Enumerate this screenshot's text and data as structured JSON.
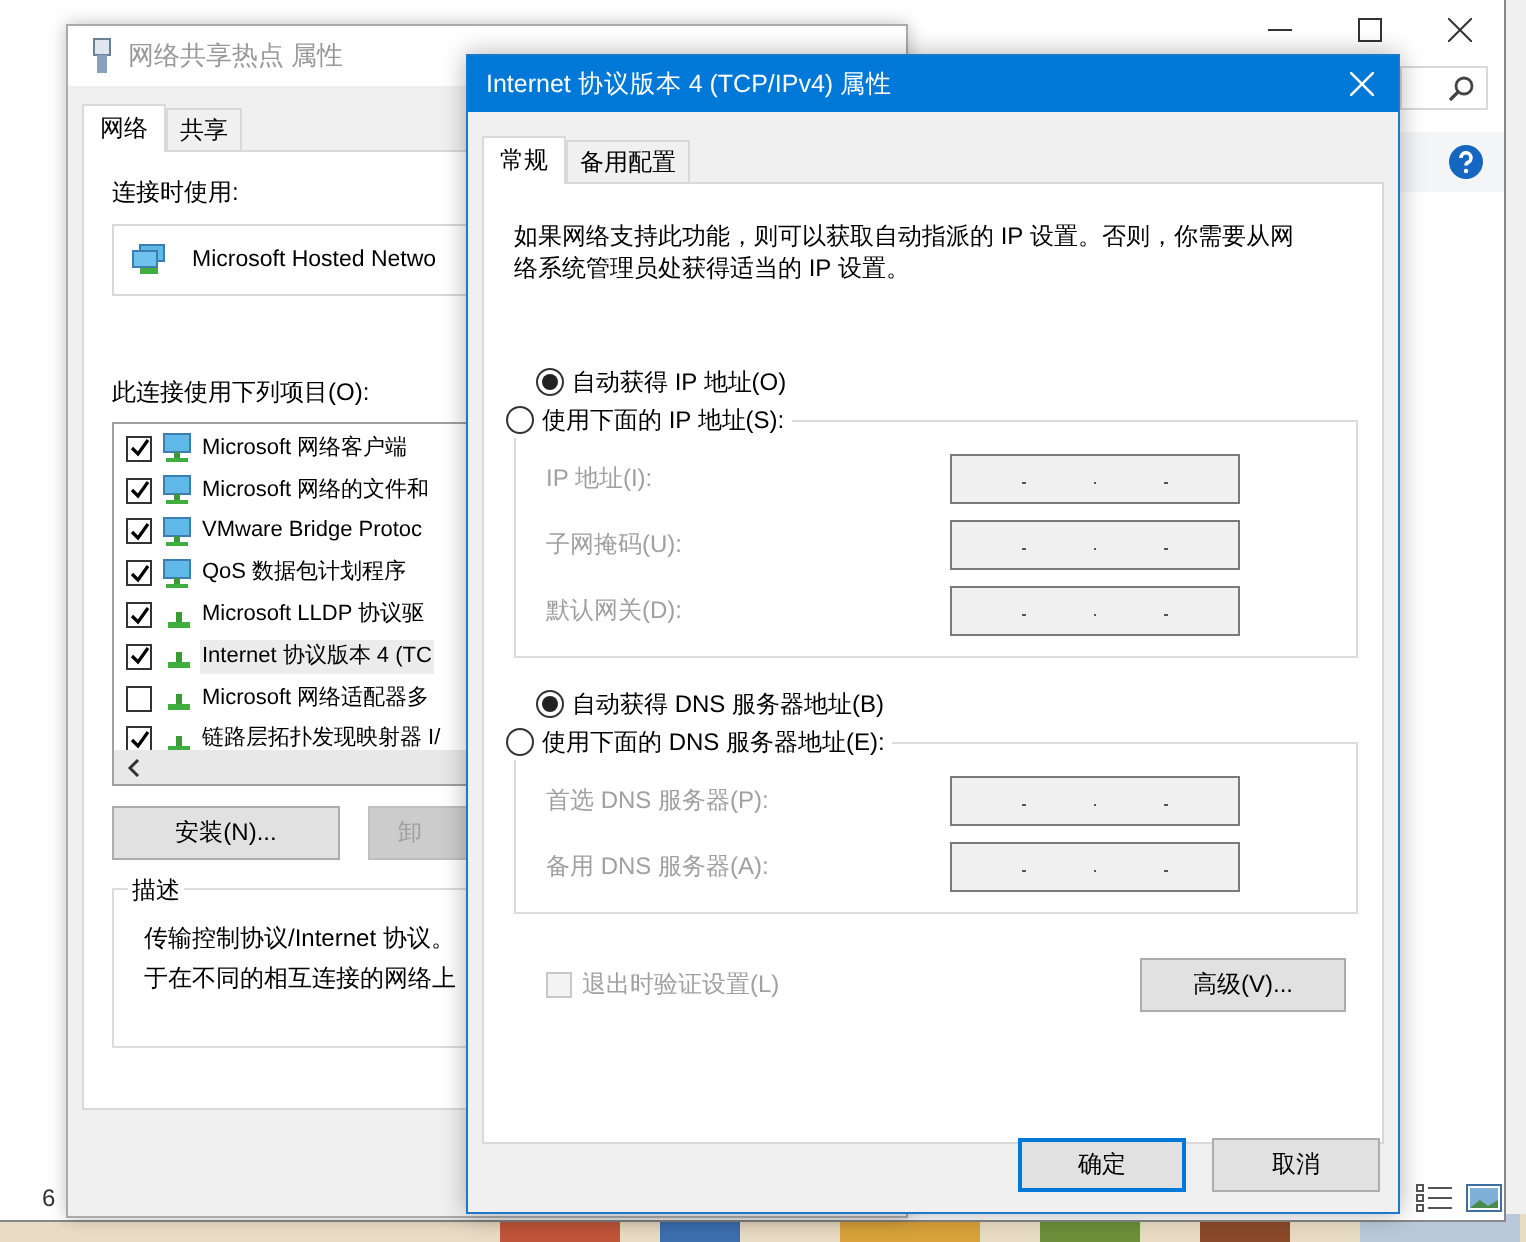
{
  "background_window": {
    "status_text": "6"
  },
  "hotspot_window": {
    "title": "网络共享热点 属性",
    "tabs": [
      {
        "label": "网络",
        "selected": true
      },
      {
        "label": "共享",
        "selected": false
      }
    ],
    "connect_using_label": "连接时使用:",
    "adapter": "Microsoft Hosted Netwo",
    "items_label": "此连接使用下列项目(O):",
    "items": [
      {
        "label": "Microsoft 网络客户端",
        "kind": "service",
        "checked": true,
        "selected": false
      },
      {
        "label": "Microsoft 网络的文件和",
        "kind": "service",
        "checked": true,
        "selected": false
      },
      {
        "label": "VMware Bridge Protoc",
        "kind": "service",
        "checked": true,
        "selected": false
      },
      {
        "label": "QoS 数据包计划程序",
        "kind": "service",
        "checked": true,
        "selected": false
      },
      {
        "label": "Microsoft LLDP 协议驱",
        "kind": "protocol",
        "checked": true,
        "selected": false
      },
      {
        "label": "Internet 协议版本 4 (TC",
        "kind": "protocol",
        "checked": true,
        "selected": true
      },
      {
        "label": "Microsoft 网络适配器多",
        "kind": "protocol",
        "checked": false,
        "selected": false
      },
      {
        "label": "链路层拓扑发现映射器 I/",
        "kind": "protocol",
        "checked": true,
        "selected": false
      }
    ],
    "buttons": [
      {
        "label": "安装(N)...",
        "disabled": false
      },
      {
        "label": "卸",
        "disabled": true
      }
    ],
    "description": {
      "title": "描述",
      "lines": [
        "传输控制协议/Internet 协议。",
        "于在不同的相互连接的网络上"
      ]
    }
  },
  "ipv4_dialog": {
    "title": "Internet 协议版本 4 (TCP/IPv4) 属性",
    "tabs": [
      {
        "label": "常规",
        "selected": true
      },
      {
        "label": "备用配置",
        "selected": false
      }
    ],
    "intro": "如果网络支持此功能，则可以获取自动指派的 IP 设置。否则，你需要从网络系统管理员处获得适当的 IP 设置。",
    "ip_options": [
      {
        "label": "自动获得 IP 地址(O)",
        "selected": true
      },
      {
        "label": "使用下面的 IP 地址(S):",
        "selected": false
      }
    ],
    "ip_fields": [
      {
        "label": "IP 地址(I):",
        "disabled": true
      },
      {
        "label": "子网掩码(U):",
        "disabled": true
      },
      {
        "label": "默认网关(D):",
        "disabled": true
      }
    ],
    "dns_options": [
      {
        "label": "自动获得 DNS 服务器地址(B)",
        "selected": true
      },
      {
        "label": "使用下面的 DNS 服务器地址(E):",
        "selected": false
      }
    ],
    "dns_fields": [
      {
        "label": "首选 DNS 服务器(P):",
        "disabled": true
      },
      {
        "label": "备用 DNS 服务器(A):",
        "disabled": true
      }
    ],
    "validate": {
      "label": "退出时验证设置(L)",
      "checked": false,
      "disabled": true
    },
    "advanced_button": "高级(V)...",
    "buttons": [
      {
        "label": "确定",
        "default": true
      },
      {
        "label": "取消",
        "default": false
      }
    ]
  }
}
